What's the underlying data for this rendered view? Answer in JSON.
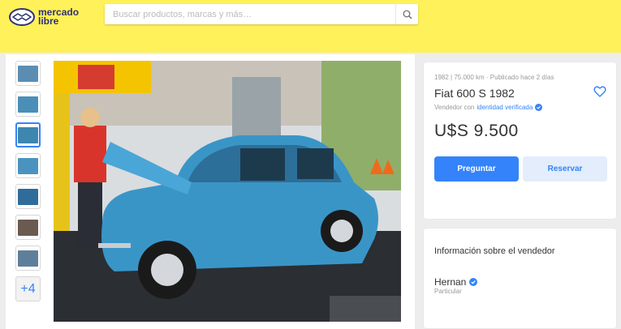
{
  "header": {
    "logo_text_line1": "mercado",
    "logo_text_line2": "libre",
    "search_placeholder": "Buscar productos, marcas y más…",
    "brand_color": "#fff159"
  },
  "gallery": {
    "thumbnails": [
      {
        "name": "thumb-1",
        "color": "#5b8db3"
      },
      {
        "name": "thumb-2",
        "color": "#4a8fb8"
      },
      {
        "name": "thumb-3",
        "color": "#3d86b0",
        "active": true
      },
      {
        "name": "thumb-4",
        "color": "#4b93bf"
      },
      {
        "name": "thumb-5",
        "color": "#2f6c9a"
      },
      {
        "name": "thumb-6",
        "color": "#6a5a4f"
      },
      {
        "name": "thumb-7",
        "color": "#5e7f9a"
      }
    ],
    "more_label": "+4"
  },
  "listing": {
    "meta": "1982 | 75.000 km · Publicado hace 2 días",
    "title": "Fiat 600 S 1982",
    "seller_prefix": "Vendedor con",
    "seller_link": "identidad verificada",
    "price": "U$S 9.500",
    "primary_button": "Preguntar",
    "secondary_button": "Reservar",
    "accent_color": "#3483fa"
  },
  "seller": {
    "heading": "Información sobre el vendedor",
    "name": "Hernan",
    "type": "Particular"
  }
}
